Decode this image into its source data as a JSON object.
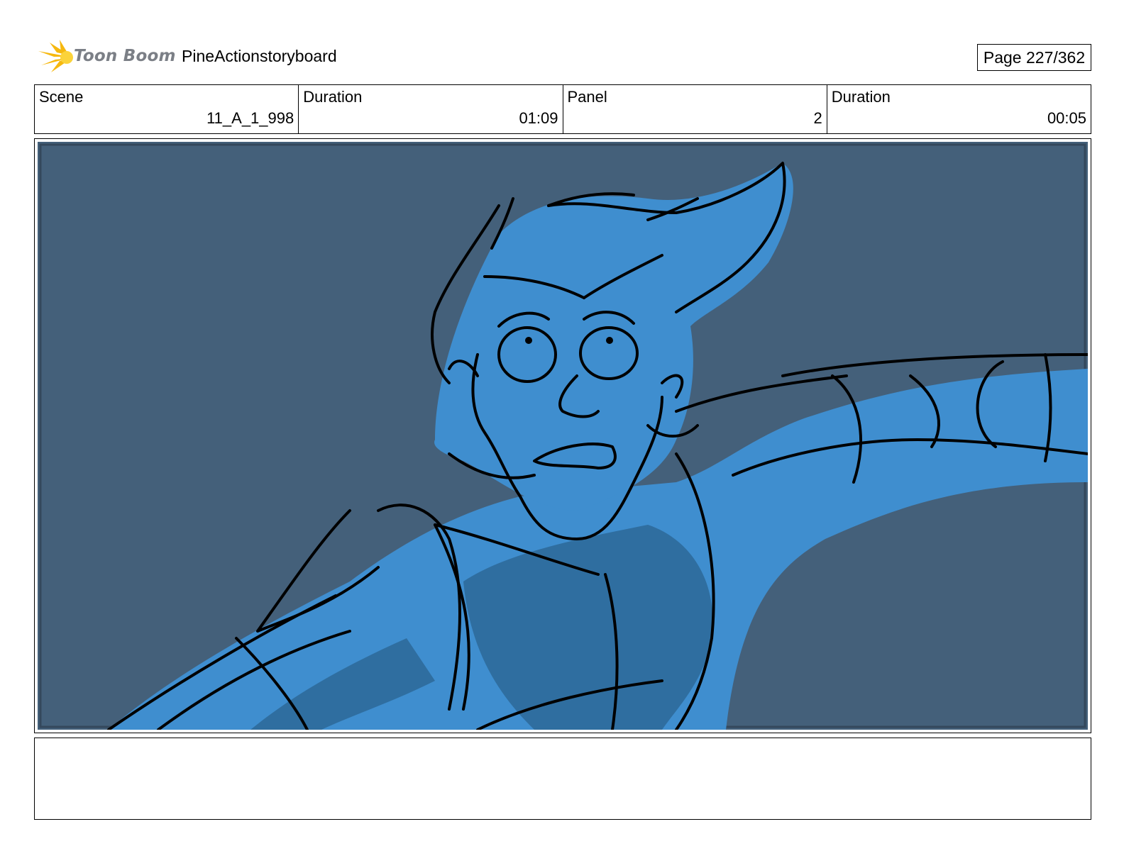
{
  "header": {
    "logo_text": "Toon Boom",
    "project_title": "PineActionstoryboard",
    "page_label": "Page 227/362"
  },
  "info": {
    "scene_label": "Scene",
    "scene_value": "11_A_1_998",
    "scene_duration_label": "Duration",
    "scene_duration_value": "01:09",
    "panel_label": "Panel",
    "panel_value": "2",
    "panel_duration_label": "Duration",
    "panel_duration_value": "00:05"
  },
  "panel": {
    "background_color": "#44607a",
    "character_fill": "#3f8ecf",
    "character_shadow": "#2f6ea0",
    "line_color": "#000000"
  },
  "notes": {
    "text": ""
  }
}
